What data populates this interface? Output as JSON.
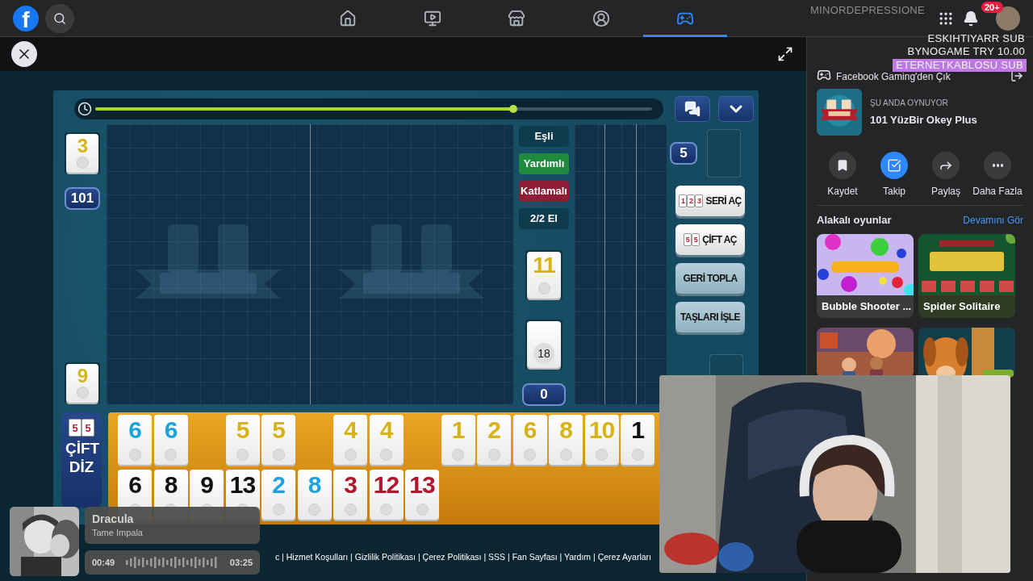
{
  "topbar": {
    "logo": "f",
    "nav": [
      {
        "kind": "home",
        "selected": false
      },
      {
        "kind": "video",
        "selected": false
      },
      {
        "kind": "marketplace",
        "selected": false
      },
      {
        "kind": "groups",
        "selected": false
      },
      {
        "kind": "gaming",
        "selected": true
      }
    ],
    "notifications_badge": "20+"
  },
  "stream_alerts": [
    {
      "kind": "faded",
      "text": "MINORDEPRESSIONE"
    },
    {
      "kind": "plain",
      "text": "ESKIHTIYARR SUB"
    },
    {
      "kind": "plain",
      "text": "BYNOGAME TRY 10.00"
    },
    {
      "kind": "highlight",
      "text": "ETERNETKABLOSU SUB"
    }
  ],
  "game": {
    "timer": {
      "level": 0.75
    },
    "left_tiles": [
      {
        "value": "3",
        "color": "#d6b418"
      },
      {
        "value": "9",
        "color": "#d6b418"
      }
    ],
    "left_badge": "101",
    "right_badge": "5",
    "bottom_badge": "0",
    "mode_tags": [
      {
        "label": "Eşli",
        "color": "#0f3b4e"
      },
      {
        "label": "Yardımlı",
        "color": "#1e8a3e"
      },
      {
        "label": "Katlamalı",
        "color": "#8e1d36"
      },
      {
        "label": "2/2 El",
        "color": "#0f3b4e"
      }
    ],
    "indicator_tile": {
      "value": "11",
      "color": "#d6b418"
    },
    "deck_count": "18",
    "actions": [
      {
        "kind": "cards",
        "label": "SERİ AÇ",
        "icon_digits": [
          "1",
          "2",
          "3"
        ]
      },
      {
        "kind": "cards",
        "label": "ÇİFT AÇ",
        "icon_digits": [
          "5",
          "5"
        ]
      },
      {
        "kind": "plain",
        "label": "GERİ TOPLA"
      },
      {
        "kind": "plain",
        "label": "TAŞLARI İŞLE"
      }
    ],
    "rack_button": {
      "label": "ÇİFT DİZ",
      "icon_digits": [
        "5",
        "5"
      ]
    },
    "rack": {
      "rows": [
        [
          {
            "kind": "tile",
            "value": "6",
            "color": "#1ea3d8"
          },
          {
            "kind": "tile",
            "value": "6",
            "color": "#1ea3d8"
          },
          {
            "kind": "empty"
          },
          {
            "kind": "tile",
            "value": "5",
            "color": "#d6b418"
          },
          {
            "kind": "tile",
            "value": "5",
            "color": "#d6b418"
          },
          {
            "kind": "empty"
          },
          {
            "kind": "tile",
            "value": "4",
            "color": "#d6b418"
          },
          {
            "kind": "tile",
            "value": "4",
            "color": "#d6b418"
          },
          {
            "kind": "empty"
          },
          {
            "kind": "tile",
            "value": "1",
            "color": "#d6b418"
          },
          {
            "kind": "tile",
            "value": "2",
            "color": "#d6b418"
          },
          {
            "kind": "tile",
            "value": "6",
            "color": "#d6b418"
          },
          {
            "kind": "tile",
            "value": "8",
            "color": "#d6b418"
          },
          {
            "kind": "tile",
            "value": "10",
            "color": "#d6b418"
          },
          {
            "kind": "tile",
            "value": "1",
            "color": "#111111"
          }
        ],
        [
          {
            "kind": "tile",
            "value": "6",
            "color": "#111111"
          },
          {
            "kind": "tile",
            "value": "8",
            "color": "#111111"
          },
          {
            "kind": "tile",
            "value": "9",
            "color": "#111111"
          },
          {
            "kind": "tile",
            "value": "13",
            "color": "#111111"
          },
          {
            "kind": "tile",
            "value": "2",
            "color": "#1ea3d8"
          },
          {
            "kind": "tile",
            "value": "8",
            "color": "#1ea3d8"
          },
          {
            "kind": "tile",
            "value": "3",
            "color": "#b01830"
          },
          {
            "kind": "tile",
            "value": "12",
            "color": "#b01830"
          },
          {
            "kind": "tile",
            "value": "13",
            "color": "#b01830"
          }
        ]
      ]
    },
    "footer": "c | Hizmet Koşulları | Gizlilik Politikası | Çerez Politikası | SSS | Fan Sayfası | Yardım | Çerez Ayarları"
  },
  "panel": {
    "exit_label": "Facebook Gaming'den Çık",
    "now_playing": {
      "caption": "ŞU ANDA OYNUYOR",
      "title": "101 YüzBir Okey Plus"
    },
    "actions": [
      {
        "kind": "save",
        "label": "Kaydet",
        "selected": false
      },
      {
        "kind": "follow",
        "label": "Takip",
        "selected": true
      },
      {
        "kind": "share",
        "label": "Paylaş",
        "selected": false
      },
      {
        "kind": "more",
        "label": "Daha Fazla",
        "selected": false
      }
    ],
    "related": {
      "title": "Alakalı oyunlar",
      "link": "Devamını Gör",
      "games": [
        {
          "kind": "captioned",
          "title": "Bubble Shooter ..."
        },
        {
          "kind": "captioned",
          "title": "Spider Solitaire"
        },
        {
          "kind": "picture"
        },
        {
          "kind": "picture"
        }
      ]
    }
  },
  "music": {
    "title": "Dracula",
    "artist": "Tame Impala",
    "elapsed": "00:49",
    "duration": "03:25"
  }
}
